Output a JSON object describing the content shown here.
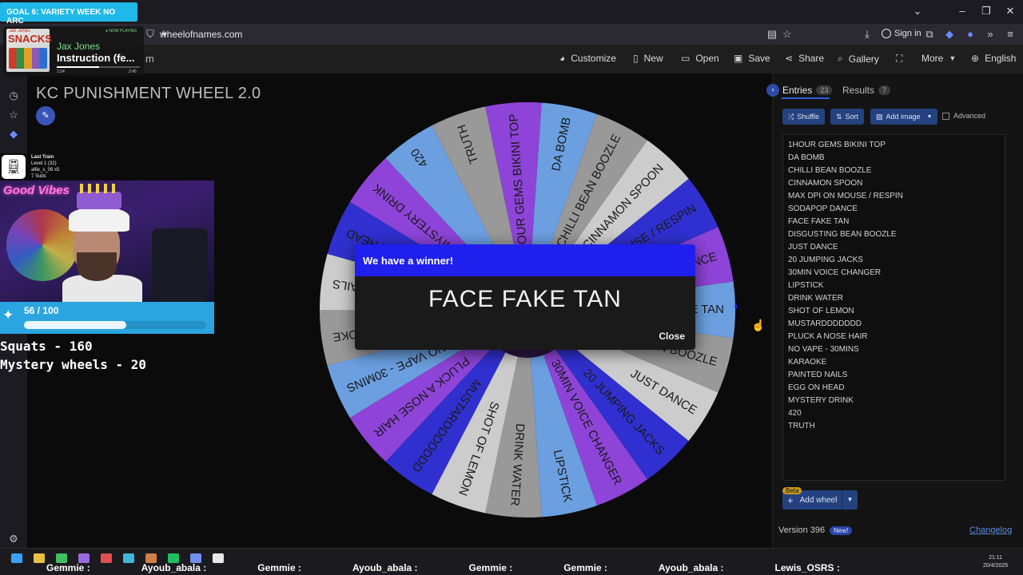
{
  "browser": {
    "url": "wheelofnames.com",
    "signin": "Sign in"
  },
  "app": {
    "logo_fragment": "m",
    "menu": {
      "customize": "Customize",
      "new": "New",
      "open": "Open",
      "save": "Save",
      "share": "Share",
      "gallery": "Gallery",
      "more": "More",
      "language": "English"
    },
    "wheel_title": "KC PUNISHMENT WHEEL 2.0",
    "wheel_segment_colors": [
      "#8e44d8",
      "#6b9fe0",
      "#999999",
      "#cccccc",
      "#3030d0"
    ]
  },
  "dialog": {
    "header": "We have a winner!",
    "winner": "FACE FAKE TAN",
    "close_label": "Close"
  },
  "panel": {
    "tabs": {
      "entries_label": "Entries",
      "entries_count": "23",
      "results_label": "Results",
      "results_count": "7"
    },
    "buttons": {
      "shuffle": "Shuffle",
      "sort": "Sort",
      "add_image": "Add image",
      "advanced": "Advanced"
    },
    "entries": [
      "1HOUR GEMS BIKINI TOP",
      "DA BOMB",
      "CHILLI BEAN BOOZLE",
      "CINNAMON SPOON",
      "MAX DPI ON MOUSE / RESPIN",
      "SODAPOP DANCE",
      "FACE FAKE TAN",
      "DISGUSTING BEAN BOOZLE",
      "JUST DANCE",
      "20 JUMPING JACKS",
      "30MIN VOICE CHANGER",
      "LIPSTICK",
      "DRINK WATER",
      "SHOT OF LEMON",
      "MUSTARDDDDDDD",
      "PLUCK A NOSE HAIR",
      "NO VAPE - 30MINS",
      "KARAOKE",
      "PAINTED NAILS",
      "EGG ON HEAD",
      "MYSTERY DRINK",
      "420",
      "TRUTH"
    ],
    "beta_label": "Beta",
    "add_wheel": "Add wheel",
    "version": "Version 396",
    "new_badge": "New!",
    "changelog": "Changelog"
  },
  "overlay": {
    "goal": "GOAL 6: VARIETY WEEK NO ARC",
    "now_playing": {
      "tag": "● NOW PLAYING",
      "art_label": "SNACKS",
      "art_artist": "Jax Jones",
      "artist": "Jax Jones",
      "title": "Instruction (fe...",
      "elapsed": "1:24",
      "duration": "2:45",
      "progress": 0.51
    },
    "sub_train": {
      "title": "Last Train",
      "level": "Level 1  (32)",
      "user": "alfie_s_09 x5",
      "subs": "7 Subs"
    },
    "webcam_sign": "Good Vibes",
    "progress": {
      "label": "56 / 100",
      "value": 0.56
    },
    "stats": [
      "Squats - 160",
      "Mystery wheels - 20"
    ]
  },
  "taskbar": {
    "ticker": [
      "Gemmie :",
      "Ayoub_abala :",
      "Gemmie :",
      "Ayoub_abala :",
      "Gemmie :",
      "Gemmie :",
      "Ayoub_abala :",
      "Lewis_OSRS :"
    ],
    "time": "21:11",
    "date": "20/4/2025"
  }
}
